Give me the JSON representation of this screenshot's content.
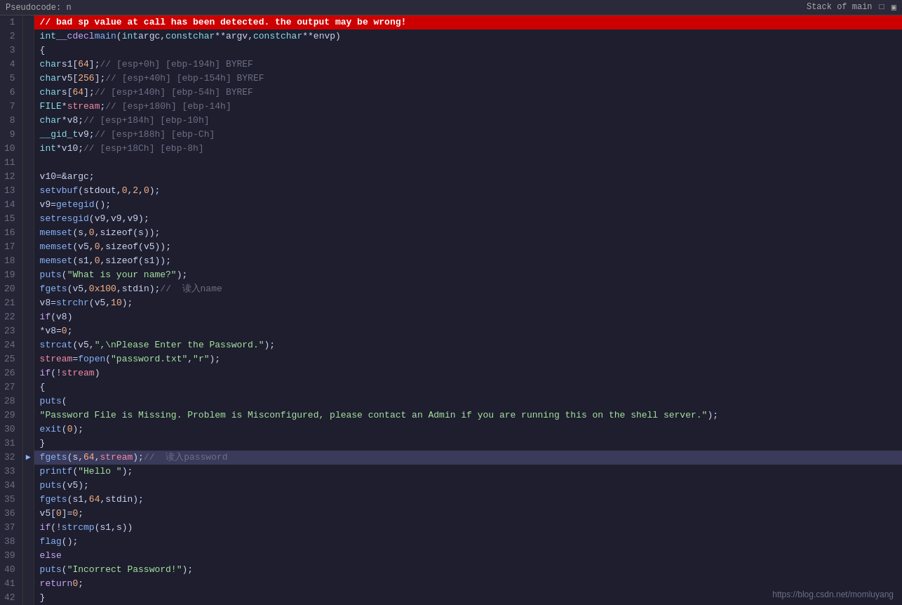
{
  "topbar": {
    "left_label": "Pseudocode: n",
    "right_label": "Stack of main",
    "icons": [
      "square-icon",
      "tab-icon"
    ]
  },
  "watermark": "https://blog.csdn.net/momluyang",
  "lines": [
    {
      "num": 1,
      "gutter": "",
      "content": "error",
      "raw": "// bad sp value at call has been detected. the output may be wrong!",
      "type": "error"
    },
    {
      "num": 2,
      "gutter": "",
      "content": "int __cdecl main(int argc, const char **argv, const char **envp)",
      "type": "normal"
    },
    {
      "num": 3,
      "gutter": "",
      "content": "{",
      "type": "normal"
    },
    {
      "num": 4,
      "gutter": "",
      "content": "    char s1[64]; // [esp+0h] [ebp-194h] BYREF",
      "type": "normal"
    },
    {
      "num": 5,
      "gutter": "",
      "content": "    char v5[256]; // [esp+40h] [ebp-154h] BYREF",
      "type": "normal"
    },
    {
      "num": 6,
      "gutter": "",
      "content": "    char s[64]; // [esp+140h] [ebp-54h] BYREF",
      "type": "normal"
    },
    {
      "num": 7,
      "gutter": "",
      "content": "    FILE *stream; // [esp+180h] [ebp-14h]",
      "type": "normal"
    },
    {
      "num": 8,
      "gutter": "",
      "content": "    char *v8; // [esp+184h] [ebp-10h]",
      "type": "normal"
    },
    {
      "num": 9,
      "gutter": "",
      "content": "    __gid_t v9; // [esp+188h] [ebp-Ch]",
      "type": "normal"
    },
    {
      "num": 10,
      "gutter": "",
      "content": "    int *v10; // [esp+18Ch] [ebp-8h]",
      "type": "normal"
    },
    {
      "num": 11,
      "gutter": "",
      "content": "",
      "type": "normal"
    },
    {
      "num": 12,
      "gutter": "",
      "content": "    v10 = &argc;",
      "type": "normal"
    },
    {
      "num": 13,
      "gutter": "",
      "content": "    setvbuf(stdout, 0, 2, 0);",
      "type": "normal"
    },
    {
      "num": 14,
      "gutter": "",
      "content": "    v9 = getegid();",
      "type": "normal"
    },
    {
      "num": 15,
      "gutter": "",
      "content": "    setresgid(v9, v9, v9);",
      "type": "normal"
    },
    {
      "num": 16,
      "gutter": "",
      "content": "    memset(s, 0, sizeof(s));",
      "type": "normal"
    },
    {
      "num": 17,
      "gutter": "",
      "content": "    memset(v5, 0, sizeof(v5));",
      "type": "normal"
    },
    {
      "num": 18,
      "gutter": "",
      "content": "    memset(s1, 0, sizeof(s1));",
      "type": "normal"
    },
    {
      "num": 19,
      "gutter": "",
      "content": "    puts(\"What is your name?\");",
      "type": "normal"
    },
    {
      "num": 20,
      "gutter": "",
      "content": "    fgets(v5, 0x100, stdin);                    //  读入name",
      "type": "normal"
    },
    {
      "num": 21,
      "gutter": "",
      "content": "    v8 = strchr(v5, 10);",
      "type": "normal"
    },
    {
      "num": 22,
      "gutter": "",
      "content": "    if ( v8 )",
      "type": "normal"
    },
    {
      "num": 23,
      "gutter": "",
      "content": "        *v8 = 0;",
      "type": "normal"
    },
    {
      "num": 24,
      "gutter": "",
      "content": "    strcat(v5, \",\\nPlease Enter the Password.\");",
      "type": "normal"
    },
    {
      "num": 25,
      "gutter": "",
      "content": "    stream = fopen(\"password.txt\", \"r\");",
      "type": "normal"
    },
    {
      "num": 26,
      "gutter": "",
      "content": "    if ( !stream )",
      "type": "normal"
    },
    {
      "num": 27,
      "gutter": "",
      "content": "    {",
      "type": "normal"
    },
    {
      "num": 28,
      "gutter": "",
      "content": "        puts(",
      "type": "normal"
    },
    {
      "num": 29,
      "gutter": "",
      "content": "            \"Password File is Missing. Problem is Misconfigured, please contact an Admin if you are running this on the shell server.\");",
      "type": "normal"
    },
    {
      "num": 30,
      "gutter": "",
      "content": "        exit(0);",
      "type": "normal"
    },
    {
      "num": 31,
      "gutter": "",
      "content": "    }",
      "type": "normal"
    },
    {
      "num": 32,
      "gutter": "",
      "content": "    fgets(s, 64, stream);                        //  读入password",
      "type": "highlighted"
    },
    {
      "num": 33,
      "gutter": "",
      "content": "    printf(\"Hello \");",
      "type": "normal"
    },
    {
      "num": 34,
      "gutter": "",
      "content": "    puts(v5);",
      "type": "normal"
    },
    {
      "num": 35,
      "gutter": "",
      "content": "    fgets(s1, 64, stdin);",
      "type": "normal"
    },
    {
      "num": 36,
      "gutter": "",
      "content": "    v5[0] = 0;",
      "type": "normal"
    },
    {
      "num": 37,
      "gutter": "",
      "content": "    if ( !strcmp(s1, s) )",
      "type": "normal"
    },
    {
      "num": 38,
      "gutter": "",
      "content": "        flag();",
      "type": "normal"
    },
    {
      "num": 39,
      "gutter": "",
      "content": "    else",
      "type": "normal"
    },
    {
      "num": 40,
      "gutter": "",
      "content": "        puts(\"Incorrect Password!\");",
      "type": "normal"
    },
    {
      "num": 41,
      "gutter": "",
      "content": "    return 0;",
      "type": "normal"
    },
    {
      "num": 42,
      "gutter": "",
      "content": "}",
      "type": "normal"
    }
  ]
}
